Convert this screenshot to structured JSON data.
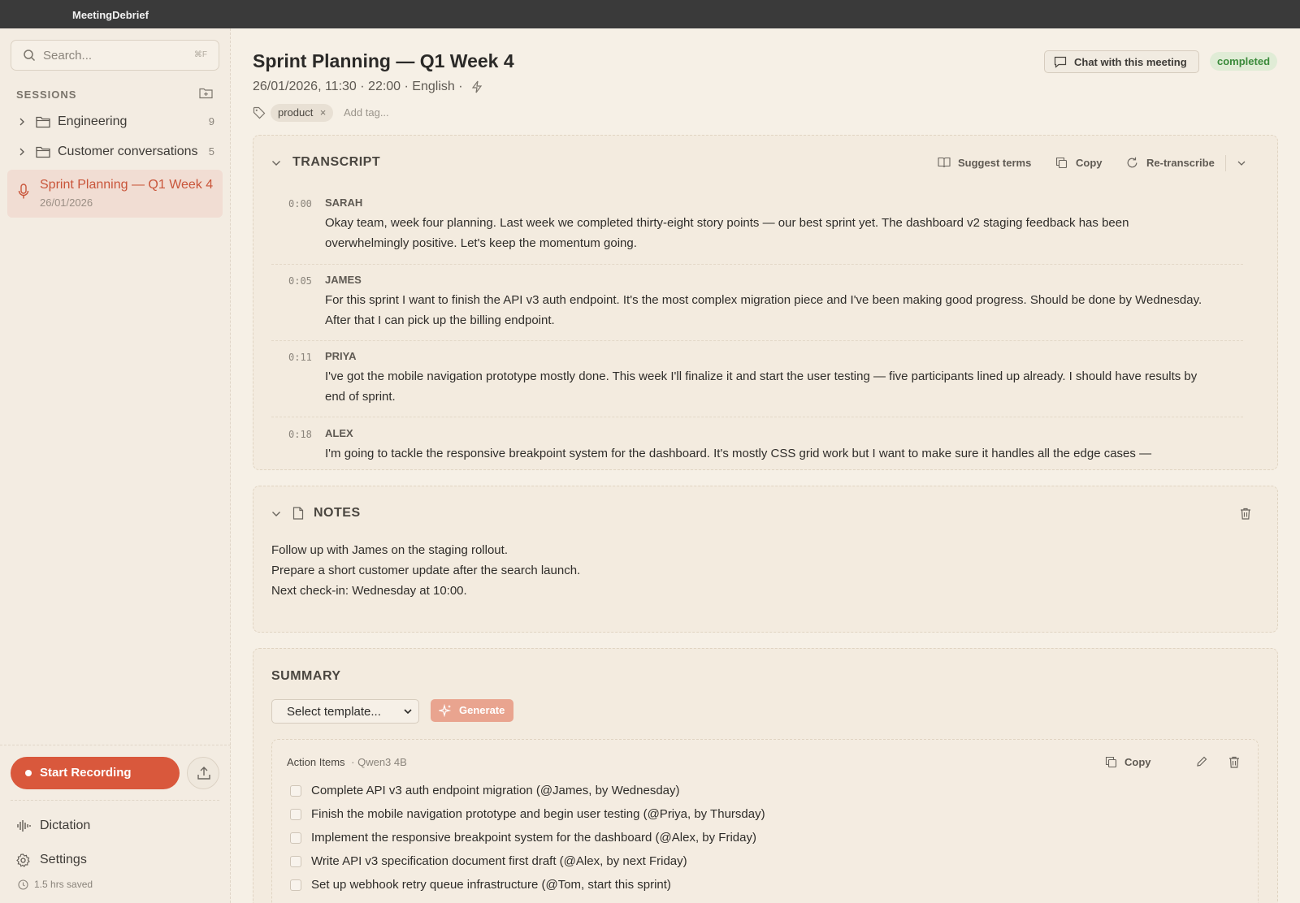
{
  "app": {
    "title": "MeetingDebrief"
  },
  "sidebar": {
    "search_placeholder": "Search...",
    "search_shortcut": "⌘F",
    "sessions_label": "SESSIONS",
    "folders": [
      {
        "name": "Engineering",
        "count": "9"
      },
      {
        "name": "Customer conversations",
        "count": "5"
      }
    ],
    "active_session": {
      "title": "Sprint Planning — Q1 Week 4",
      "date": "26/01/2026"
    },
    "record_label": "Start Recording",
    "nav": [
      {
        "label": "Dictation"
      },
      {
        "label": "Settings"
      }
    ],
    "saved_text": "1.5 hrs saved"
  },
  "meeting": {
    "title": "Sprint Planning — Q1 Week 4",
    "meta": "26/01/2026, 11:30  · 22:00  · English  ·",
    "tags": [
      "product"
    ],
    "add_tag_placeholder": "Add tag...",
    "chat_label": "Chat with this meeting",
    "status": "completed"
  },
  "transcript": {
    "title": "TRANSCRIPT",
    "tools": {
      "suggest": "Suggest terms",
      "copy": "Copy",
      "retranscribe": "Re-transcribe"
    },
    "entries": [
      {
        "time": "0:00",
        "speaker": "SARAH",
        "text": "Okay team, week four planning. Last week we completed thirty-eight story points — our best sprint yet. The dashboard v2 staging feedback has been overwhelmingly positive. Let's keep the momentum going."
      },
      {
        "time": "0:05",
        "speaker": "JAMES",
        "text": "For this sprint I want to finish the API v3 auth endpoint. It's the most complex migration piece and I've been making good progress. Should be done by Wednesday. After that I can pick up the billing endpoint."
      },
      {
        "time": "0:11",
        "speaker": "PRIYA",
        "text": "I've got the mobile navigation prototype mostly done. This week I'll finalize it and start the user testing — five participants lined up already. I should have results by end of sprint."
      },
      {
        "time": "0:18",
        "speaker": "ALEX",
        "text": "I'm going to tackle the responsive breakpoint system for the dashboard. It's mostly CSS grid work but I want to make sure it handles all the edge cases —"
      }
    ]
  },
  "notes": {
    "title": "NOTES",
    "lines": [
      "Follow up with James on the staging rollout.",
      "Prepare a short customer update after the search launch.",
      "Next check-in: Wednesday at 10:00."
    ]
  },
  "summary": {
    "title": "SUMMARY",
    "template_placeholder": "Select template...",
    "generate_label": "Generate",
    "card": {
      "title": "Action Items",
      "model": "· Qwen3 4B",
      "copy_label": "Copy",
      "items": [
        "Complete API v3 auth endpoint migration (@James, by Wednesday)",
        "Finish the mobile navigation prototype and begin user testing (@Priya, by Thursday)",
        "Implement the responsive breakpoint system for the dashboard (@Alex, by Friday)",
        "Write API v3 specification document first draft (@Alex, by next Friday)",
        "Set up webhook retry queue infrastructure (@Tom, start this sprint)"
      ]
    }
  },
  "colors": {
    "accent": "#d9583c",
    "status_green": "#3a8a3a",
    "background": "#f6f0e6"
  }
}
